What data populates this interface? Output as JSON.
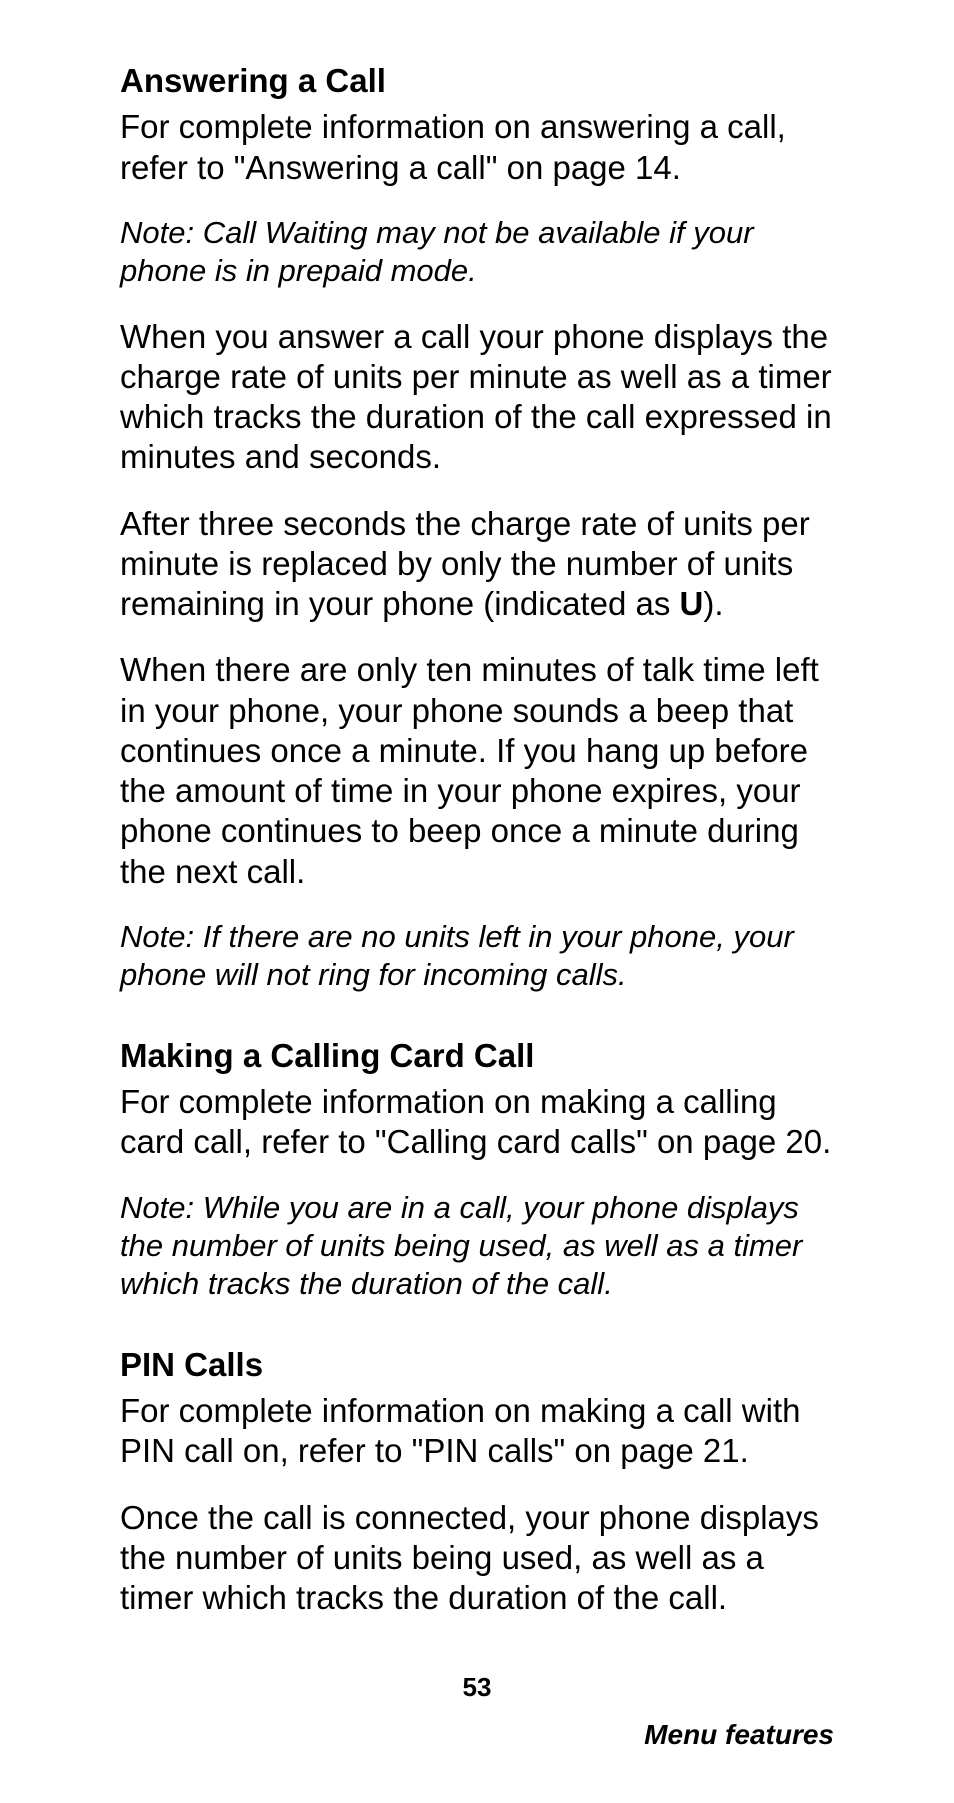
{
  "sections": {
    "answering": {
      "heading": "Answering a Call",
      "p1": "For complete information on answering a call, refer to \"Answering a call\" on page 14.",
      "note1_label": "Note:",
      "note1_body": "  Call Waiting may not be available if your phone is in prepaid mode.",
      "p2": "When you answer a call your phone displays the charge rate of units per minute as well as a timer which tracks the duration of the call expressed in minutes and seconds.",
      "p3_pre": "After three seconds the charge rate of units per minute is replaced by only the number of units remaining in your phone (indicated as ",
      "p3_bold": "U",
      "p3_post": ").",
      "p4": "When there are only ten minutes of talk time left in your phone, your phone sounds a beep that continues once a minute. If you hang up before the amount of time in your phone expires, your phone continues to beep once a minute during the next call.",
      "note2_label": "Note:",
      "note2_body": " If there are no units left in your phone, your phone will not ring for incoming calls."
    },
    "calling_card": {
      "heading": "Making a Calling Card Call",
      "p1": "For complete information on making a calling card call, refer to \"Calling card calls\" on page 20.",
      "note1_label": "Note:",
      "note1_body": " While you are in a call, your phone displays the number of units being used, as well as a timer which tracks the duration of the call."
    },
    "pin": {
      "heading": "PIN Calls",
      "p1": "For complete information on making a call with PIN call on, refer to \"PIN calls\" on page 21.",
      "p2": "Once the call is connected, your phone displays the number of units being used, as well as a timer which tracks the duration of the call."
    }
  },
  "footer": {
    "page_number": "53",
    "section_label": "Menu features"
  }
}
